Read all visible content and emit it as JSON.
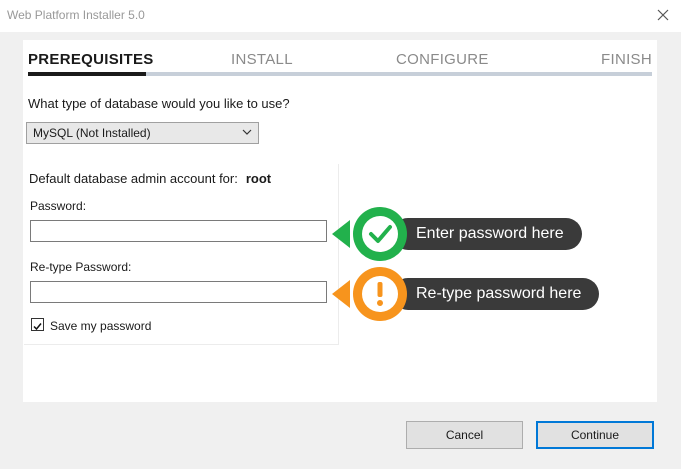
{
  "window": {
    "title": "Web Platform Installer 5.0"
  },
  "steps": [
    {
      "label": "PREREQUISITES",
      "active": true
    },
    {
      "label": "INSTALL",
      "active": false
    },
    {
      "label": "CONFIGURE",
      "active": false
    },
    {
      "label": "FINISH",
      "active": false
    }
  ],
  "database": {
    "question": "What type of database would you like to use?",
    "selected": "MySQL (Not Installed)"
  },
  "account": {
    "label": "Default database admin account for:",
    "username": "root",
    "password_label": "Password:",
    "password_value": "",
    "retype_label": "Re-type Password:",
    "retype_value": "",
    "save_label": "Save my password",
    "save_checked": true
  },
  "tips": {
    "password": {
      "text": "Enter password here",
      "status": "valid",
      "color": "#22b14c",
      "icon": "checkmark-icon"
    },
    "retype": {
      "text": "Re-type password here",
      "status": "warning",
      "color": "#f7941d",
      "icon": "exclamation-icon"
    }
  },
  "buttons": {
    "cancel": "Cancel",
    "continue": "Continue"
  },
  "colors": {
    "step_active": "#1a1a1a",
    "step_track": "#c7cfd9",
    "primary_border": "#0078d7",
    "tooltip_bg": "#3a3a3a"
  }
}
